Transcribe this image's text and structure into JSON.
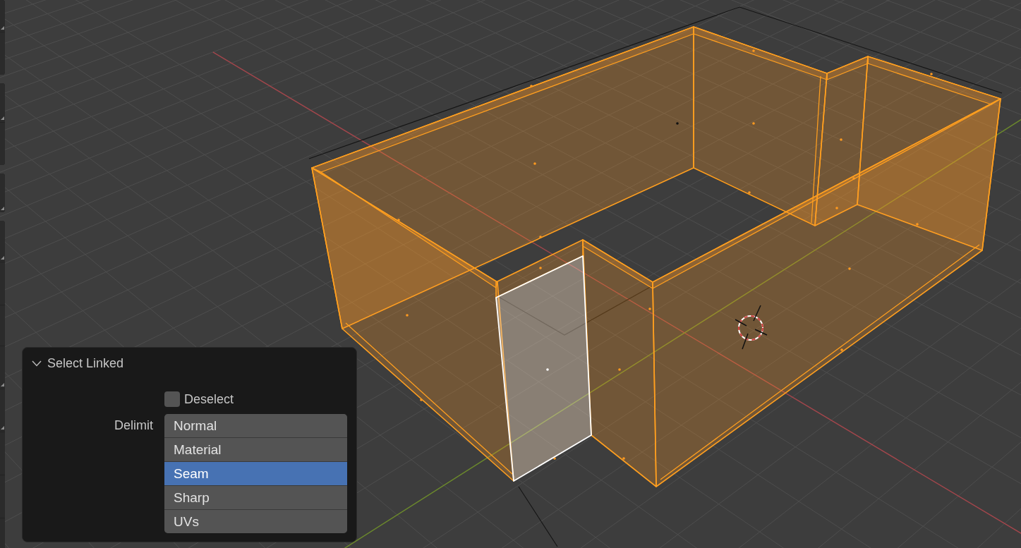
{
  "panel": {
    "title": "Select Linked",
    "expanded": true,
    "deselect": {
      "label": "Deselect",
      "checked": false
    },
    "delimit": {
      "label": "Delimit",
      "options": [
        {
          "label": "Normal",
          "selected": false
        },
        {
          "label": "Material",
          "selected": false
        },
        {
          "label": "Seam",
          "selected": true
        },
        {
          "label": "Sharp",
          "selected": false
        },
        {
          "label": "UVs",
          "selected": false
        }
      ]
    }
  }
}
